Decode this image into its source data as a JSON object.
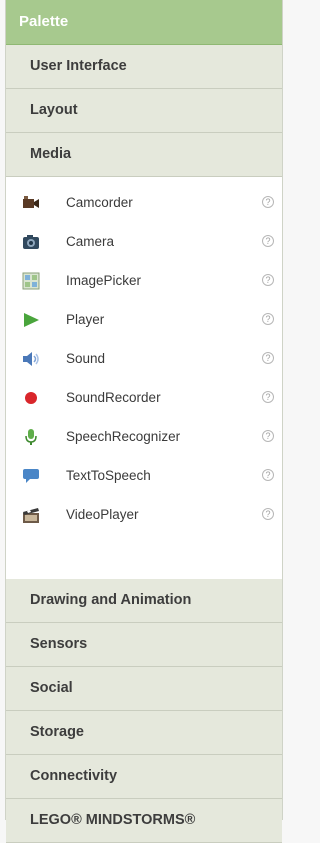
{
  "palette": {
    "title": "Palette"
  },
  "categories_top": [
    {
      "label": "User Interface"
    },
    {
      "label": "Layout"
    },
    {
      "label": "Media"
    }
  ],
  "media_items": [
    {
      "label": "Camcorder",
      "icon": "camcorder-icon"
    },
    {
      "label": "Camera",
      "icon": "camera-icon"
    },
    {
      "label": "ImagePicker",
      "icon": "image-picker-icon"
    },
    {
      "label": "Player",
      "icon": "player-icon"
    },
    {
      "label": "Sound",
      "icon": "sound-icon"
    },
    {
      "label": "SoundRecorder",
      "icon": "sound-recorder-icon"
    },
    {
      "label": "SpeechRecognizer",
      "icon": "speech-recognizer-icon"
    },
    {
      "label": "TextToSpeech",
      "icon": "text-to-speech-icon"
    },
    {
      "label": "VideoPlayer",
      "icon": "video-player-icon"
    }
  ],
  "help_glyph": "?",
  "categories_bottom": [
    {
      "label": "Drawing and Animation"
    },
    {
      "label": "Sensors"
    },
    {
      "label": "Social"
    },
    {
      "label": "Storage"
    },
    {
      "label": "Connectivity"
    },
    {
      "label": "LEGO® MINDSTORMS®"
    }
  ],
  "colors": {
    "header_bg": "#a7c98e",
    "category_bg": "#e5e8dc",
    "item_bg": "#ffffff"
  }
}
